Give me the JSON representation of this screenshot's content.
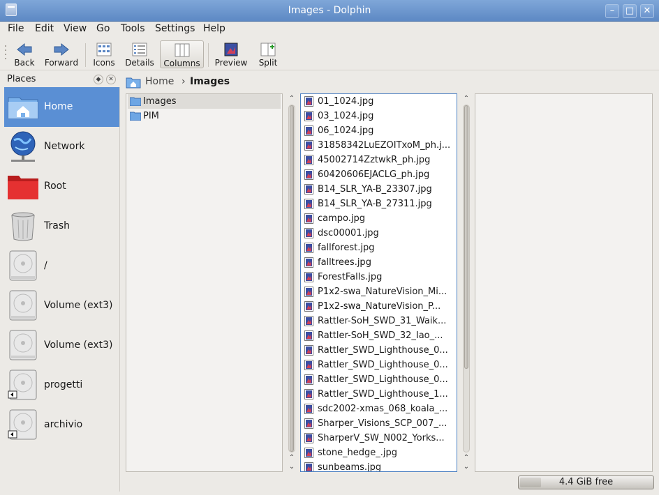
{
  "window": {
    "title": "Images - Dolphin"
  },
  "menu": [
    "File",
    "Edit",
    "View",
    "Go",
    "Tools",
    "Settings",
    "Help"
  ],
  "toolbar": {
    "back": "Back",
    "forward": "Forward",
    "icons": "Icons",
    "details": "Details",
    "columns": "Columns",
    "preview": "Preview",
    "split": "Split",
    "active_view": "Columns"
  },
  "places": {
    "title": "Places",
    "items": [
      {
        "label": "Home",
        "icon": "home-icon",
        "selected": true
      },
      {
        "label": "Network",
        "icon": "network-icon"
      },
      {
        "label": "Root",
        "icon": "red-folder-icon"
      },
      {
        "label": "Trash",
        "icon": "trash-icon"
      },
      {
        "label": "/",
        "icon": "hard-disk-icon"
      },
      {
        "label": "Volume (ext3)",
        "icon": "hard-disk-icon"
      },
      {
        "label": "Volume (ext3)",
        "icon": "hard-disk-icon"
      },
      {
        "label": "progetti",
        "icon": "hard-disk-icon"
      },
      {
        "label": "archivio",
        "icon": "hard-disk-icon"
      }
    ]
  },
  "breadcrumb": {
    "home": "Home",
    "current": "Images"
  },
  "column1": [
    "Images",
    "PIM"
  ],
  "column2": [
    "01_1024.jpg",
    "03_1024.jpg",
    "06_1024.jpg",
    "31858342LuEZOITxoM_ph.j...",
    "45002714ZztwkR_ph.jpg",
    "60420606EJACLG_ph.jpg",
    "B14_SLR_YA-B_23307.jpg",
    "B14_SLR_YA-B_27311.jpg",
    "campo.jpg",
    "dsc00001.jpg",
    "fallforest.jpg",
    "falltrees.jpg",
    "ForestFalls.jpg",
    "P1x2-swa_NatureVision_Mi...",
    "P1x2-swa_NatureVision_P...",
    "Rattler-SoH_SWD_31_Waik...",
    "Rattler-SoH_SWD_32_Iao_...",
    "Rattler_SWD_Lighthouse_0...",
    "Rattler_SWD_Lighthouse_0...",
    "Rattler_SWD_Lighthouse_0...",
    "Rattler_SWD_Lighthouse_1...",
    "sdc2002-xmas_068_koala_...",
    "Sharper_Visions_SCP_007_...",
    "SharperV_SW_N002_Yorks...",
    "stone_hedge_.jpg",
    "sunbeams.jpg"
  ],
  "status": {
    "free_space": "4.4 GiB free"
  }
}
